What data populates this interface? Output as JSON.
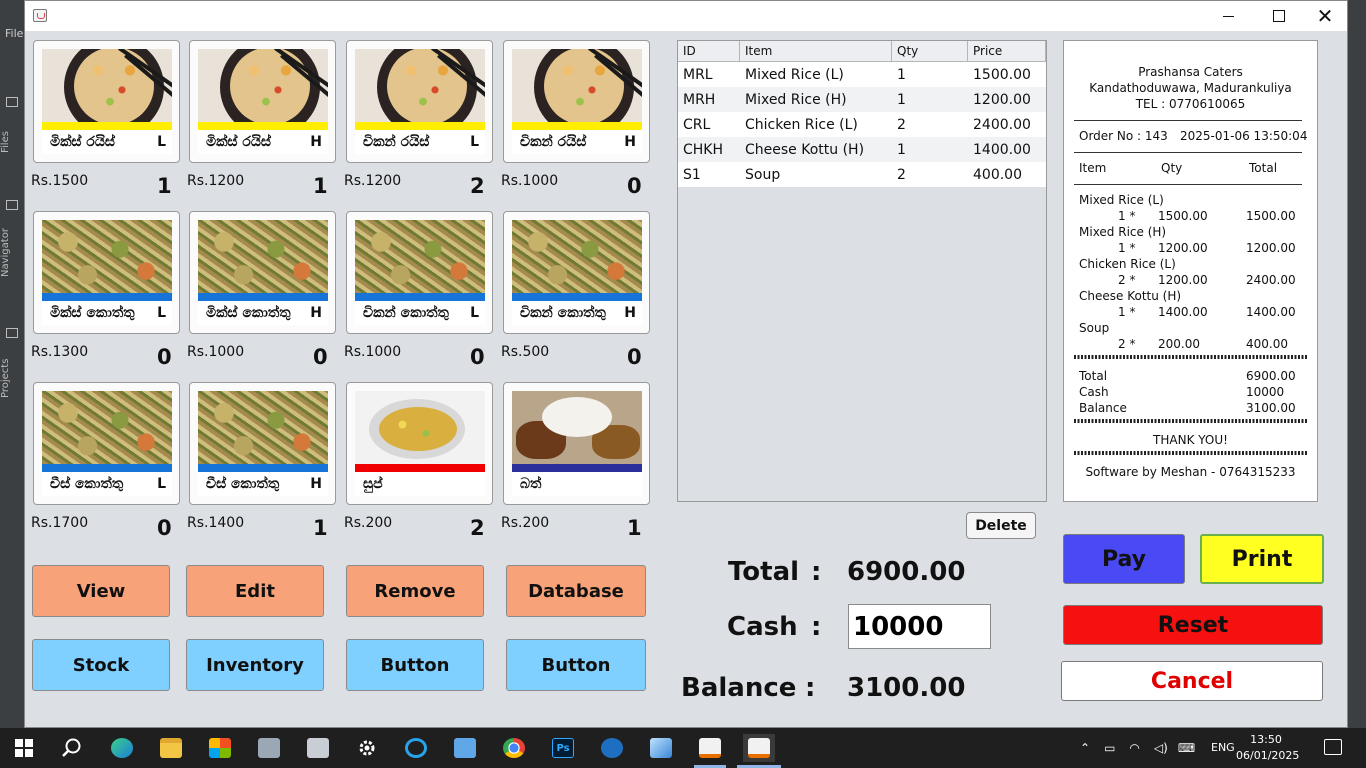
{
  "ide": {
    "menu_file": "File",
    "tabs": [
      "Files",
      "Navigator",
      "Projects"
    ]
  },
  "window": {
    "controls": {
      "minimize": "",
      "maximize": "",
      "close": "✕"
    }
  },
  "items": [
    {
      "name": "මික්ස් රයිස්",
      "size": "L",
      "price": "Rs.1500",
      "count": "1",
      "photo": "rice",
      "bar_color": "#ffee00"
    },
    {
      "name": "මික්ස් රයිස්",
      "size": "H",
      "price": "Rs.1200",
      "count": "1",
      "photo": "rice",
      "bar_color": "#ffee00"
    },
    {
      "name": "චිකන් රයිස්",
      "size": "L",
      "price": "Rs.1200",
      "count": "2",
      "photo": "rice",
      "bar_color": "#ffee00"
    },
    {
      "name": "චිකන් රයිස්",
      "size": "H",
      "price": "Rs.1000",
      "count": "0",
      "photo": "rice",
      "bar_color": "#ffee00"
    },
    {
      "name": "මික්ස් කොත්තු",
      "size": "L",
      "price": "Rs.1300",
      "count": "0",
      "photo": "kottu",
      "bar_color": "#1673d8"
    },
    {
      "name": "මික්ස් කොත්තු",
      "size": "H",
      "price": "Rs.1000",
      "count": "0",
      "photo": "kottu",
      "bar_color": "#1673d8"
    },
    {
      "name": "චිකන් කොත්තු",
      "size": "L",
      "price": "Rs.1000",
      "count": "0",
      "photo": "kottu",
      "bar_color": "#1673d8"
    },
    {
      "name": "චිකන් කොත්තු",
      "size": "H",
      "price": "Rs.500",
      "count": "0",
      "photo": "kottu",
      "bar_color": "#1673d8"
    },
    {
      "name": "චීස් කොත්තු",
      "size": "L",
      "price": "Rs.1700",
      "count": "0",
      "photo": "kottu",
      "bar_color": "#1673d8"
    },
    {
      "name": "චීස් කොත්තු",
      "size": "H",
      "price": "Rs.1400",
      "count": "1",
      "photo": "kottu",
      "bar_color": "#1673d8"
    },
    {
      "name": "සුප්",
      "size": "",
      "price": "Rs.200",
      "count": "2",
      "photo": "soup",
      "bar_color": "#f00000"
    },
    {
      "name": "බත්",
      "size": "",
      "price": "Rs.200",
      "count": "1",
      "photo": "rice2",
      "bar_color": "#2b2f9c"
    }
  ],
  "actions": {
    "view": "View",
    "edit": "Edit",
    "remove": "Remove",
    "database": "Database",
    "stock": "Stock",
    "inventory": "Inventory",
    "button1": "Button",
    "button2": "Button"
  },
  "order_table": {
    "columns": [
      "ID",
      "Item",
      "Qty",
      "Price"
    ],
    "rows": [
      [
        "MRL",
        "Mixed Rice (L)",
        "1",
        "1500.00"
      ],
      [
        "MRH",
        "Mixed Rice (H)",
        "1",
        "1200.00"
      ],
      [
        "CRL",
        "Chicken Rice (L)",
        "2",
        "2400.00"
      ],
      [
        "CHKH",
        "Cheese Kottu (H)",
        "1",
        "1400.00"
      ],
      [
        "S1",
        "Soup",
        "2",
        "400.00"
      ]
    ],
    "delete_label": "Delete"
  },
  "summary": {
    "total_label": "Total",
    "total_value": "6900.00",
    "cash_label": "Cash",
    "cash_value": "10000",
    "balance_label": "Balance",
    "balance_value": "3100.00",
    "colon": ":"
  },
  "receipt": {
    "shop": "Prashansa Caters",
    "address": "Kandathoduwawa, Madurankuliya",
    "tel": "TEL : 0770610065",
    "order_no": "Order No : 143",
    "datetime": "2025-01-06 13:50:04",
    "head_item": "Item",
    "head_qty": "Qty",
    "head_total": "Total",
    "lines": [
      {
        "name": "Mixed Rice (L)",
        "qty": "1 *",
        "unit": "1500.00",
        "total": "1500.00"
      },
      {
        "name": "Mixed Rice (H)",
        "qty": "1 *",
        "unit": "1200.00",
        "total": "1200.00"
      },
      {
        "name": "Chicken Rice (L)",
        "qty": "2 *",
        "unit": "1200.00",
        "total": "2400.00"
      },
      {
        "name": "Cheese Kottu (H)",
        "qty": "1 *",
        "unit": "1400.00",
        "total": "1400.00"
      },
      {
        "name": "Soup",
        "qty": "2 *",
        "unit": "200.00",
        "total": "400.00"
      }
    ],
    "total_label": "Total",
    "total_value": "6900.00",
    "cash_label": "Cash",
    "cash_value": "10000",
    "balance_label": "Balance",
    "balance_value": "3100.00",
    "thanks": "THANK YOU!",
    "footer": "Software by Meshan - 0764315233"
  },
  "right_buttons": {
    "pay": "Pay",
    "print": "Print",
    "reset": "Reset",
    "cancel": "Cancel"
  },
  "taskbar": {
    "apps": [
      "search-icon",
      "edge-icon",
      "file-explorer-icon",
      "store-icon",
      "photos-icon",
      "sign-icon",
      "settings-icon",
      "cortana-icon",
      "laptop-icon",
      "chrome-icon",
      "photoshop-icon",
      "vpn-icon",
      "box-icon",
      "java-icon",
      "java-icon"
    ],
    "lang": "ENG",
    "time": "13:50",
    "date": "06/01/2025"
  }
}
